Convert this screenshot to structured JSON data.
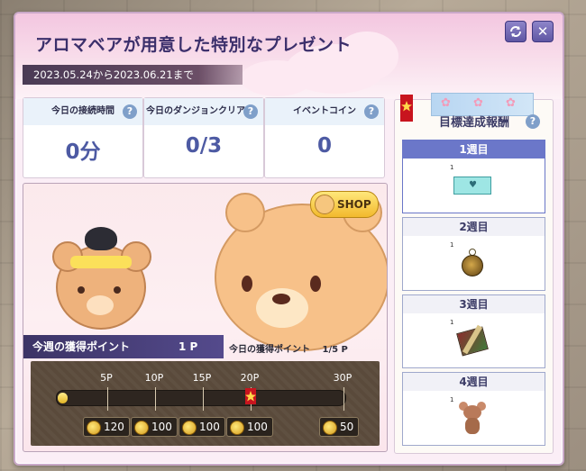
{
  "window": {
    "title": "アロマベアが用意した特別なプレゼント",
    "period": "2023.05.24から2023.06.21まで",
    "buttons": {
      "refresh_icon": "refresh-icon",
      "close_label": "✕"
    }
  },
  "stats": [
    {
      "label": "今日の接続時間",
      "value": "0分"
    },
    {
      "label": "今日のダンジョンクリア",
      "value": "0/3"
    },
    {
      "label": "イベントコイン",
      "value": "0"
    }
  ],
  "help_label": "?",
  "banner": {
    "shop_label": "SHOP",
    "week_points_label": "今週の獲得ポイント",
    "week_points_value": "1 P",
    "today_points_label": "今日の獲得ポイント",
    "today_points_value": "1/5 P",
    "progress": {
      "current_points": 1,
      "max_points": 30
    },
    "milestones": [
      "5P",
      "10P",
      "15P",
      "20P",
      "30P"
    ],
    "rewards": [
      "120",
      "100",
      "100",
      "100",
      "50"
    ]
  },
  "side": {
    "title": "目標達成報酬",
    "weeks": [
      {
        "label": "1週目",
        "item_count": "1",
        "item_icon": "ticket-icon",
        "active": true
      },
      {
        "label": "2週目",
        "item_count": "1",
        "item_icon": "pocket-watch-icon",
        "active": false
      },
      {
        "label": "3週目",
        "item_count": "1",
        "item_icon": "armor-bundle-icon",
        "active": false
      },
      {
        "label": "4週目",
        "item_count": "1",
        "item_icon": "mouse-doll-icon",
        "active": false
      }
    ]
  },
  "colors": {
    "title_text": "#3b2f6b",
    "stat_value": "#4d5aa3",
    "active_week": "#6b77c9",
    "coin": "#e2b424"
  }
}
